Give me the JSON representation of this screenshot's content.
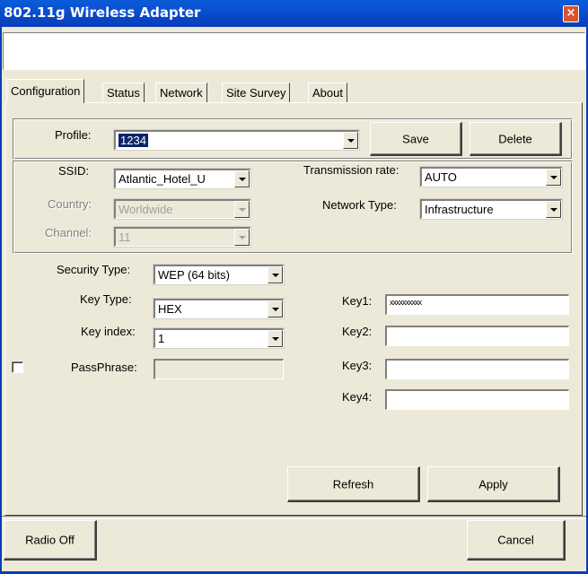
{
  "window": {
    "title": "802.11g Wireless Adapter",
    "close_glyph": "×"
  },
  "tabs": [
    {
      "label": "Configuration"
    },
    {
      "label": "Status"
    },
    {
      "label": "Network"
    },
    {
      "label": "Site Survey"
    },
    {
      "label": "About"
    }
  ],
  "profile": {
    "label": "Profile:",
    "value": "1234",
    "save_label": "Save",
    "delete_label": "Delete"
  },
  "network": {
    "ssid_label": "SSID:",
    "ssid_value": "Atlantic_Hotel_U",
    "country_label": "Country:",
    "country_value": "Worldwide",
    "channel_label": "Channel:",
    "channel_value": "11",
    "tx_rate_label": "Transmission rate:",
    "tx_rate_value": "AUTO",
    "network_type_label": "Network Type:",
    "network_type_value": "Infrastructure"
  },
  "security": {
    "security_type_label": "Security Type:",
    "security_type_value": "WEP (64 bits)",
    "key_type_label": "Key Type:",
    "key_type_value": "HEX",
    "key_index_label": "Key index:",
    "key_index_value": "1",
    "passphrase_label": "PassPhrase:",
    "passphrase_value": "",
    "key1_label": "Key1:",
    "key1_value": "xxxxxxxxxx",
    "key2_label": "Key2:",
    "key2_value": "",
    "key3_label": "Key3:",
    "key3_value": "",
    "key4_label": "Key4:",
    "key4_value": ""
  },
  "actions": {
    "refresh_label": "Refresh",
    "apply_label": "Apply"
  },
  "footer": {
    "radio_off_label": "Radio Off",
    "cancel_label": "Cancel"
  },
  "colors": {
    "titlebar": "#0a4fd0",
    "face": "#ece9d8",
    "selection": "#0a246a",
    "close": "#d9532c"
  }
}
